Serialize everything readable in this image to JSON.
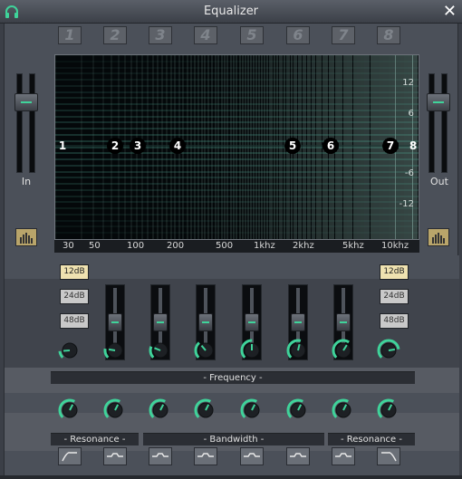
{
  "window": {
    "title": "Equalizer",
    "close_label": "✕"
  },
  "graph": {
    "db_labels": [
      "12",
      "6",
      "0",
      "-6",
      "-12"
    ],
    "freq_labels": [
      "30",
      "50",
      "100",
      "200",
      "500",
      "1khz",
      "2khz",
      "5khz",
      "10khz"
    ],
    "nodes": [
      "1",
      "2",
      "3",
      "4",
      "5",
      "6",
      "7",
      "8"
    ]
  },
  "meters": {
    "in_label": "In",
    "out_label": "Out"
  },
  "bands": {
    "numbers": [
      "1",
      "2",
      "3",
      "4",
      "5",
      "6",
      "7",
      "8"
    ],
    "gain_levels": [
      null,
      0.5,
      0.5,
      0.5,
      0.5,
      0.5,
      0.5,
      null
    ],
    "freq_knob_values": [
      0.15,
      0.2,
      0.25,
      0.35,
      0.5,
      0.55,
      0.62,
      0.8
    ],
    "res_knob_values": [
      0.6,
      0.6,
      0.6,
      0.6,
      0.6,
      0.6,
      0.6,
      0.6
    ]
  },
  "slope_buttons": {
    "low": [
      "12dB",
      "24dB",
      "48dB"
    ],
    "high": [
      "12dB",
      "24dB",
      "48dB"
    ],
    "selected": "12dB"
  },
  "sections": {
    "frequency": "- Frequency -",
    "resonance_left": "- Resonance -",
    "bandwidth": "- Bandwidth -",
    "resonance_right": "- Resonance -"
  },
  "colors": {
    "accent": "#3fd39a",
    "active_button": "#efe2b0",
    "panel": "#4b5059"
  }
}
